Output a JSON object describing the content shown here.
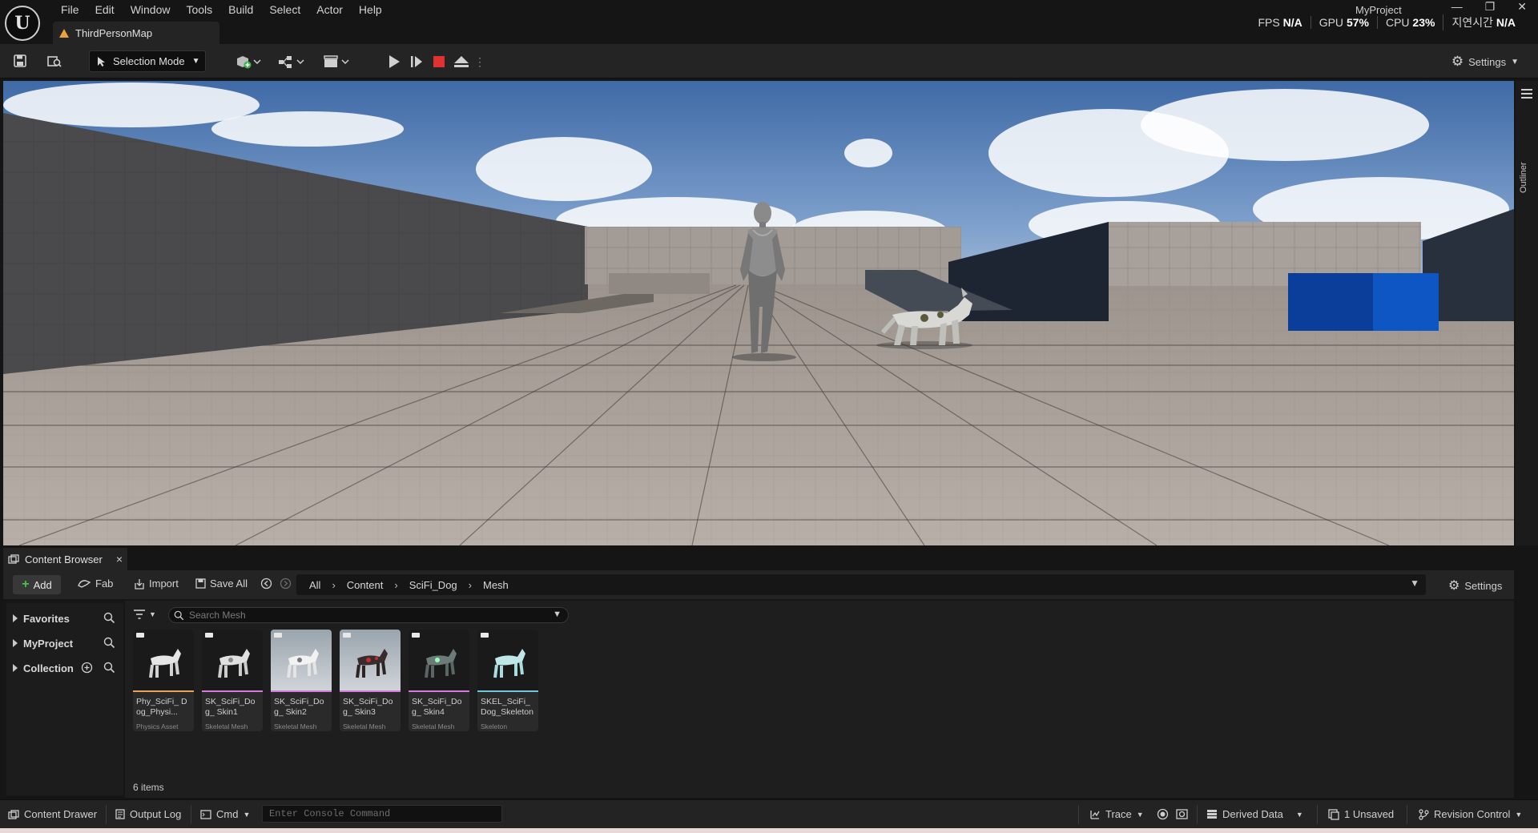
{
  "app": {
    "logo_text": "U",
    "project_name": "MyProject",
    "map_tab": "ThirdPersonMap",
    "window_controls": [
      "—",
      "❐",
      "✕"
    ]
  },
  "menu": [
    "File",
    "Edit",
    "Window",
    "Tools",
    "Build",
    "Select",
    "Actor",
    "Help"
  ],
  "stats": {
    "fps_label": "FPS",
    "fps_value": "N/A",
    "gpu_label": "GPU",
    "gpu_value": "57%",
    "cpu_label": "CPU",
    "cpu_value": "23%",
    "latency_label": "지연시간",
    "latency_value": "N/A"
  },
  "toolbar": {
    "selection_mode": "Selection Mode",
    "settings": "Settings"
  },
  "outliner": {
    "label": "Outliner"
  },
  "content_browser": {
    "tab_label": "Content Browser",
    "add": "Add",
    "fab": "Fab",
    "import": "Import",
    "save_all": "Save All",
    "path": [
      "All",
      "Content",
      "SciFi_Dog",
      "Mesh"
    ],
    "settings": "Settings",
    "sources": [
      "Favorites",
      "MyProject",
      "Collection"
    ],
    "search_placeholder": "Search Mesh",
    "items_count": "6 items",
    "assets": [
      {
        "name": "Phy_SciFi_ Dog_Physi...",
        "type": "Physics Asset",
        "color": "#e8a25a"
      },
      {
        "name": "SK_SciFi_Dog_ Skin1",
        "type": "Skeletal Mesh",
        "color": "#d67adf"
      },
      {
        "name": "SK_SciFi_Dog_ Skin2",
        "type": "Skeletal Mesh",
        "color": "#d67adf"
      },
      {
        "name": "SK_SciFi_Dog_ Skin3",
        "type": "Skeletal Mesh",
        "color": "#d67adf"
      },
      {
        "name": "SK_SciFi_Dog_ Skin4",
        "type": "Skeletal Mesh",
        "color": "#d67adf"
      },
      {
        "name": "SKEL_SciFi_ Dog_Skeleton",
        "type": "Skeleton",
        "color": "#6ec7d8"
      }
    ]
  },
  "statusbar": {
    "content_drawer": "Content Drawer",
    "output_log": "Output Log",
    "cmd": "Cmd",
    "console_placeholder": "Enter Console Command",
    "trace": "Trace",
    "derived_data": "Derived Data",
    "unsaved": "1 Unsaved",
    "revision_control": "Revision Control"
  },
  "colors": {
    "play_stop": "#e03232",
    "add_plus": "#44c24a",
    "warning": "#e8a235"
  }
}
